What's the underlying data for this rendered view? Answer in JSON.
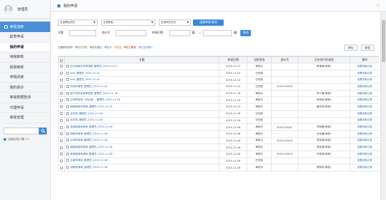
{
  "sidebar": {
    "username": "管理员",
    "section": "审批流转",
    "items": [
      "起草申请",
      "我的申请",
      "待我审核",
      "经我审核",
      "待我阅读",
      "我的承办",
      "审批数据查询",
      "代理申请",
      "审批管理"
    ],
    "active_index": 1,
    "online_label": "当前在线人数",
    "online_count": "1人"
  },
  "topbar": {
    "title": "我的申请"
  },
  "filters": {
    "category": "全部模板类别",
    "template": "全部模板",
    "status": "全部审批状态",
    "search_button": "批量审批/查询",
    "subject_label": "主题",
    "serial_label": "流水号",
    "date_label": "申请日期",
    "date_sep": "~",
    "query_button": "查询"
  },
  "legend": {
    "prefix": "主题颜色说明：",
    "green": "审批已完成",
    "sep1": "，",
    "normal": "审批未通过",
    "sep2": "，",
    "blue": "审批中",
    "sep3": "，",
    "orange": "未发送",
    "sep4": "，",
    "red": "审批已撤销",
    "sep5": "，",
    "other": "退文至流程人"
  },
  "actions": {
    "transfer": "转存",
    "forward": "转发"
  },
  "table": {
    "headers": [
      "主题",
      "申请日期",
      "当前状态",
      "流水号",
      "正在进行的流程",
      "操作"
    ],
    "rows": [
      {
        "title": "校长使用许可审请单_管理员_2015-12-07",
        "date": "2015-12-07",
        "status": "审批中",
        "serial": "",
        "flow": "教育局(审批)",
        "op": "查看流转记录"
      },
      {
        "title": "test_管理员_2015-12-02",
        "date": "2015-12-02",
        "status": "已完成",
        "serial": "",
        "flow": "",
        "op": "查看流转记录"
      },
      {
        "title": "test_管理员_2015-12-02",
        "date": "2015-12-02",
        "status": "已完成",
        "serial": "",
        "flow": "",
        "op": "查看流转记录"
      },
      {
        "title": "项目申请表_管理员_2015-11-20",
        "date": "2015-11-20",
        "status": "已完成",
        "serial": "2015110022",
        "flow": "",
        "op": "查看流转记录"
      },
      {
        "title": "客户资料变更审请表_管理员_2015-11-18",
        "date": "2015-11-18",
        "status": "审批中",
        "serial": "",
        "flow": "符小雪(审批)",
        "op": "查看流转记录"
      },
      {
        "title": "合同审批单（供应商）_管理员_2015-11-18",
        "date": "2015-11-18",
        "status": "审批中",
        "serial": "",
        "flow": "林润军(审批)",
        "op": "查看流转记录"
      },
      {
        "title": "通用报销申请单_管理员_2015-11-14",
        "date": "2015-11-14",
        "status": "审批中",
        "serial": "",
        "flow": "姜灵伟(审批)",
        "op": "查看流转记录"
      },
      {
        "title": "用印单_管理员_2015-11-06",
        "date": "2015-11-06",
        "status": "已完成",
        "serial": "",
        "flow": "",
        "op": "查看流转记录"
      },
      {
        "title": "用印单_管理员_2015-11-06",
        "date": "2015-11-06",
        "status": "已完成",
        "serial": "",
        "flow": "",
        "op": "查看流转记录"
      },
      {
        "title": "差旅报销审请单_管理员_2015-11-06",
        "date": "2015-11-06",
        "status": "审批中",
        "serial": "2015110021",
        "flow": "李明明(审批)",
        "op": "查看流转记录"
      },
      {
        "title": "请款审请单_管理员_2015-11-06",
        "date": "2015-11-06",
        "status": "审批中",
        "serial": "",
        "flow": "在线通(审批)",
        "op": "查看流转记录"
      },
      {
        "title": "合同审批单_管理员_2015-11-06",
        "date": "2015-11-06",
        "status": "审批中",
        "serial": "2015110020",
        "flow": "财务部(审批)",
        "op": "查看流转记录"
      },
      {
        "title": "通用报销审请单_管理员_2015-11-06",
        "date": "2015-11-06",
        "status": "审批中",
        "serial": "",
        "flow": "财务部(审批)",
        "op": "查看流转记录"
      },
      {
        "title": "差旅报销审请单_管理员_2015-11-06",
        "date": "2015-11-06",
        "status": "审批中",
        "serial": "2015110019",
        "flow": "印发部(审批)",
        "op": "查看流转记录"
      },
      {
        "title": "出差审请单_管理员_2015-11-06",
        "date": "2015-11-06",
        "status": "已完成",
        "serial": "",
        "flow": "",
        "op": "查看流转记录"
      },
      {
        "title": "请假审请单_管理员_2015-11-06",
        "date": "2015-11-06",
        "status": "审批中",
        "serial": "",
        "flow": "顾明月(审批)",
        "op": "查看流转记录"
      }
    ]
  },
  "colors": {
    "accent": "#3b8ad8",
    "title_link": "#2b6cb0",
    "star": "#f0b400"
  }
}
